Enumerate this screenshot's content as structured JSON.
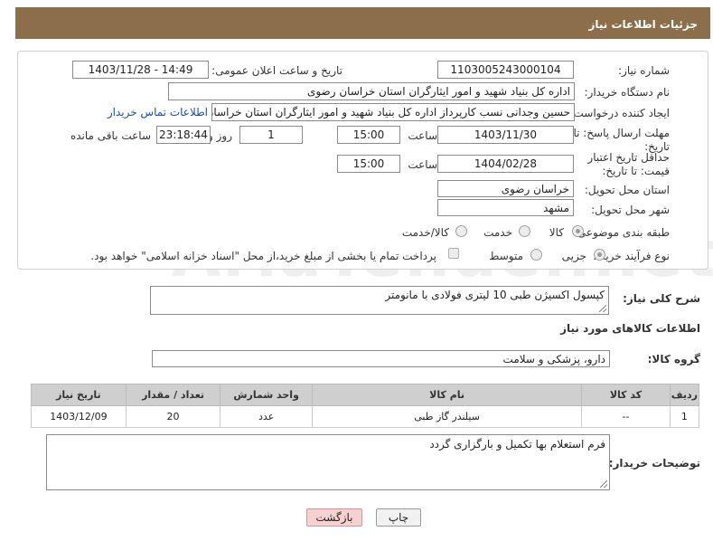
{
  "header": {
    "title": "جزئیات اطلاعات نیاز"
  },
  "form": {
    "need_number_label": "شماره نیاز:",
    "need_number": "1103005243000104",
    "announce_label": "تاریخ و ساعت اعلان عمومی:",
    "announce_value": "1403/11/28 - 14:49",
    "buyer_org_label": "نام دستگاه خریدار:",
    "buyer_org": "اداره کل بنیاد شهید و امور ایثارگران استان خراسان رضوی",
    "creator_label": "ایجاد کننده درخواست:",
    "creator": "حسین وجدانی نسب کارپرداز اداره کل بنیاد شهید و امور ایثارگران استان خراسان رضوی",
    "contact_link": "اطلاعات تماس خریدار",
    "reply_deadline_label": "مهلت ارسال پاسخ: تا تاریخ:",
    "reply_date": "1403/11/30",
    "time_label": "ساعت",
    "reply_time": "15:00",
    "days_value": "1",
    "days_label": "روز و",
    "remaining_value": "23:18:44",
    "remaining_label": "ساعت باقی مانده",
    "price_deadline_label": "حداقل تاریخ اعتبار قیمت: تا تاریخ:",
    "price_date": "1404/02/28",
    "price_time": "15:00",
    "province_label": "استان محل تحویل:",
    "province": "خراسان رضوی",
    "city_label": "شهر محل تحویل:",
    "city": "مشهد",
    "category_label": "طبقه بندی موضوعی:",
    "category_options": [
      "کالا",
      "خدمت",
      "کالا/خدمت"
    ],
    "process_label": "نوع فرآیند خرید :",
    "process_options": [
      "جزیی",
      "متوسط"
    ],
    "payment_note": "پرداخت تمام یا بخشی از مبلغ خرید،از محل \"اسناد خزانه اسلامی\" خواهد بود."
  },
  "description": {
    "label": "شرح کلی نیاز:",
    "value": "کپسول اکسیژن طبی 10 لیتری فولادی با مانومتر"
  },
  "goods_section": {
    "title": "اطلاعات کالاهای مورد نیاز"
  },
  "goods_group": {
    "label": "گروه کالا:",
    "value": "دارو، پزشکی و سلامت"
  },
  "table": {
    "headers": [
      "ردیف",
      "کد کالا",
      "نام کالا",
      "واحد شمارش",
      "تعداد / مقدار",
      "تاریخ نیاز"
    ],
    "rows": [
      [
        "1",
        "--",
        "سیلندر گاز طبی",
        "عدد",
        "20",
        "1403/12/09"
      ]
    ]
  },
  "buyer_notes": {
    "label": "توضیحات خریدار:",
    "value": "فرم استعلام بها تکمیل و بارگزاری گردد"
  },
  "buttons": {
    "print": "چاپ",
    "back": "بازگشت"
  },
  "watermark": {
    "text": "AriaTender.net"
  }
}
